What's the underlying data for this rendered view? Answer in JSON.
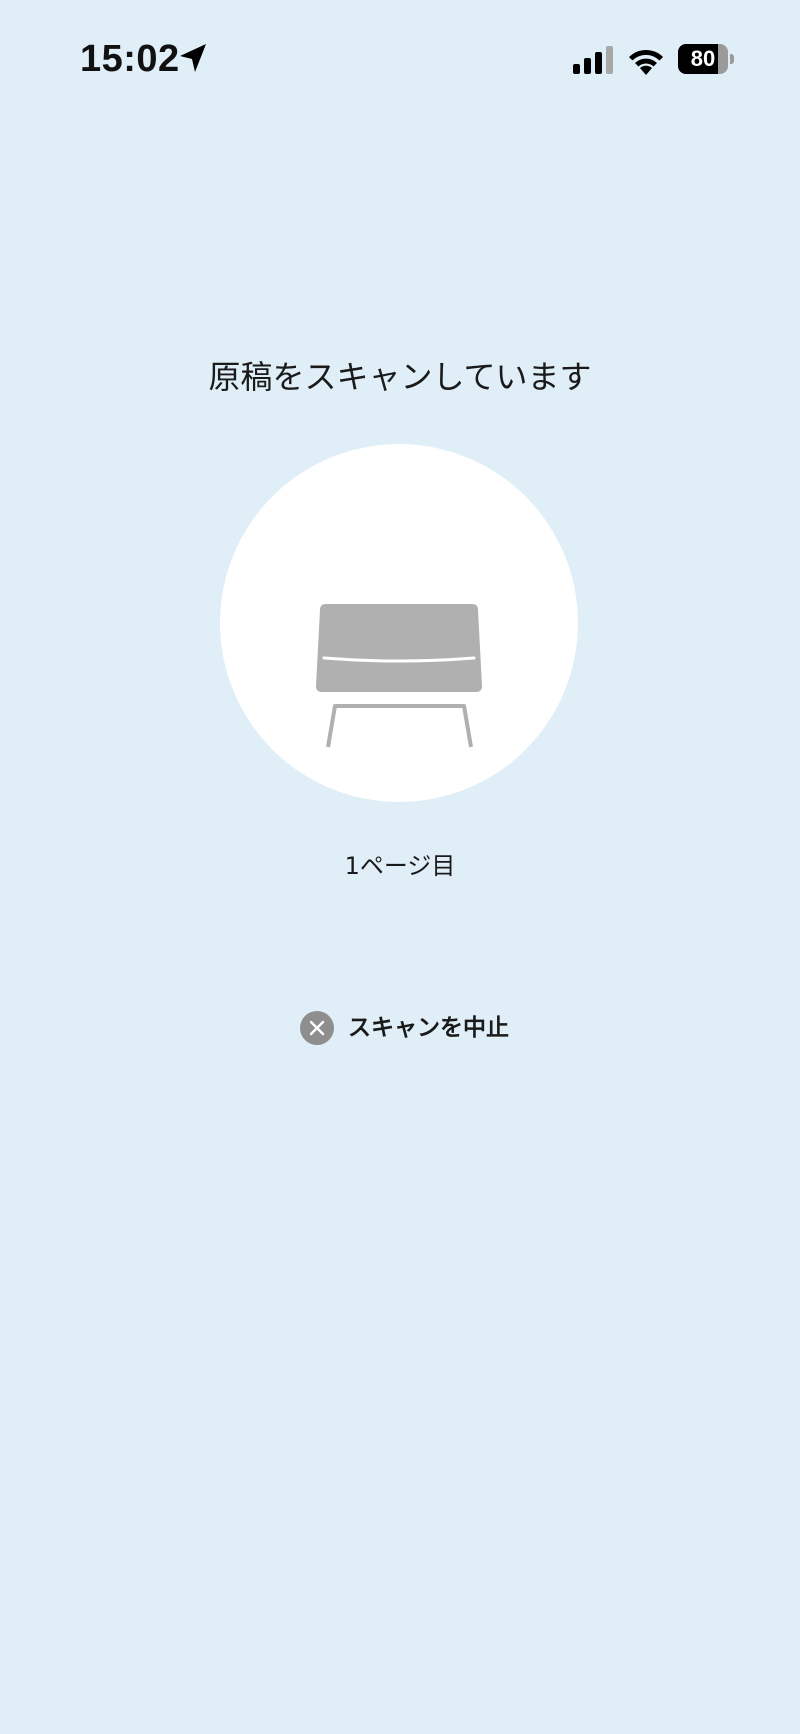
{
  "status_bar": {
    "time": "15:02",
    "battery_level": "80",
    "battery_fraction": 0.8,
    "icons": [
      "location-arrow-icon",
      "cellular-signal-icon",
      "wifi-icon",
      "battery-icon"
    ]
  },
  "scan": {
    "title": "原稿をスキャンしています",
    "page_counter": "1ページ目",
    "illustration": "scanner-icon",
    "cancel_label": "スキャンを中止",
    "cancel_icon": "close-circle-icon"
  },
  "colors": {
    "background": "#dfeef7",
    "circle": "#ffffff",
    "scanner_gray": "#b0b0b0",
    "cancel_icon_gray": "#8e8e8e"
  }
}
